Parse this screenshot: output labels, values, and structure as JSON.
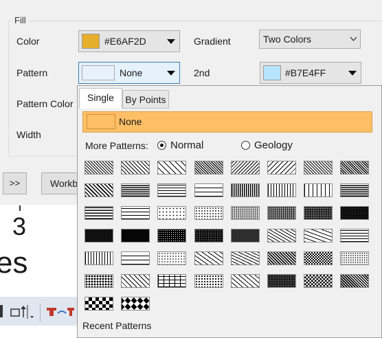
{
  "dialog": {
    "fill_group_title": "Fill",
    "color_label": "Color",
    "color_value": "#E6AF2D",
    "color_swatch": "#E6AF2D",
    "gradient_label": "Gradient",
    "gradient_value": "Two Colors",
    "pattern_label": "Pattern",
    "pattern_value": "None",
    "pattern_swatch": "#E8F2FC",
    "second_label": "2nd",
    "second_value": "#B7E4FF",
    "second_swatch": "#B7E4FF",
    "pattern_color_label": "Pattern Color",
    "width_label": "Width",
    "more_button_label": ">>",
    "workbook_button_label": "Workb"
  },
  "background": {
    "number_text": "3",
    "large_text": "es"
  },
  "popup": {
    "tabs": [
      "Single",
      "By Points"
    ],
    "active_tab": "Single",
    "none_label": "None",
    "none_color": "#FFBF66",
    "more_patterns_label": "More Patterns:",
    "radio_options": [
      "Normal",
      "Geology"
    ],
    "selected_radio": "Normal",
    "recent_label": "Recent Patterns",
    "patterns": [
      [
        "hatch-fine-diagonal",
        "hatch-diagonal",
        "hatch-wide-diagonal",
        "hatch-dense-diagonal",
        "hatch-diagonal-back",
        "hatch-wide-back",
        "crosshatch-fine",
        "crosshatch-dense"
      ],
      [
        "crosshatch-diagonal",
        "horizontal-dense",
        "horizontal-medium",
        "horizontal-wide",
        "vertical-dense",
        "vertical-medium",
        "vertical-wide",
        "grid-dense"
      ],
      [
        "grid-bold",
        "grid-medium",
        "dots-sparse",
        "dots-fine",
        "dots-medium",
        "dots-dense",
        "dots-heavy",
        "dots-heavier"
      ],
      [
        "shade-dark",
        "shade-darker",
        "shade-black-dots",
        "shade-black",
        "shade-black-fine",
        "diagonal-dashes",
        "diagonal-bricks-dashes",
        "horizontal-dashes"
      ],
      [
        "vertical-dashes",
        "grid-light",
        "confetti-small",
        "zigzag",
        "wave",
        "diagonal-weave",
        "checker-small",
        "dots-random"
      ],
      [
        "pebbles",
        "trellis",
        "bricks",
        "diamonds-dots",
        "scales",
        "dense-grid-dark",
        "checker-medium",
        "crosshatch-black"
      ],
      [
        "checker-large",
        "diamonds-large"
      ]
    ]
  }
}
